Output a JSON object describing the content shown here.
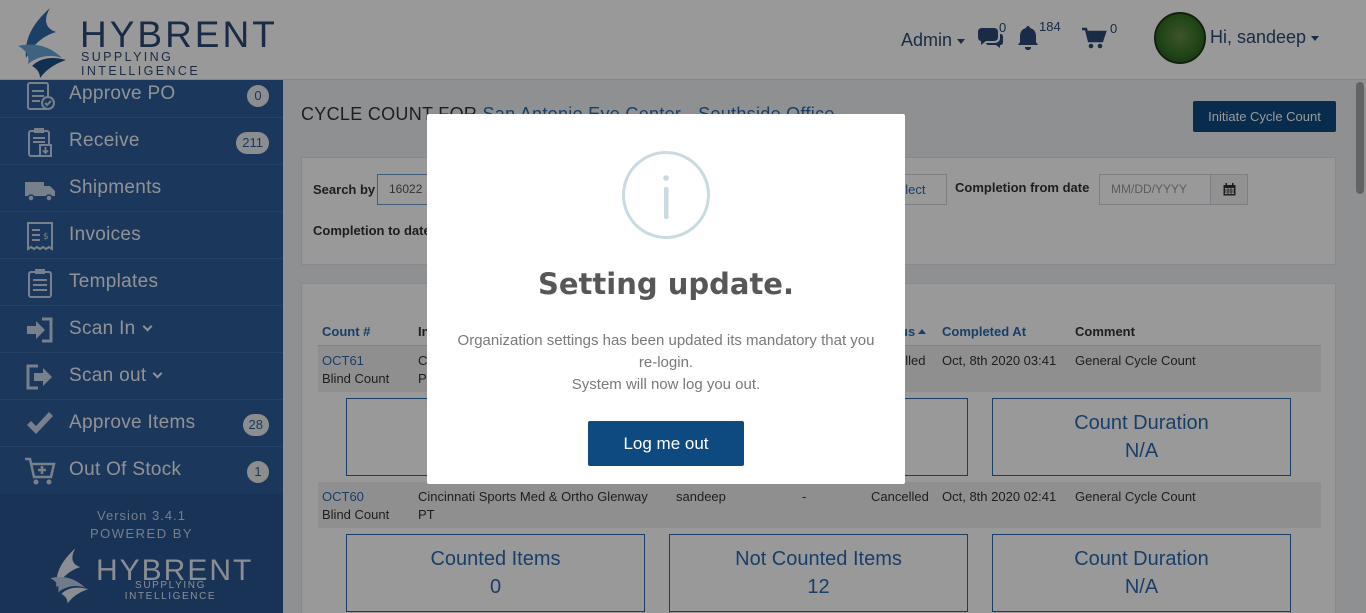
{
  "header": {
    "brand_name": "HYBRENT",
    "brand_tagline": "SUPPLYING INTELLIGENCE",
    "admin_label": "Admin",
    "messages_count": "0",
    "notifications_count": "184",
    "cart_count": "0",
    "user_greeting": "Hi, sandeep"
  },
  "sidebar": {
    "items": [
      {
        "label": "Approve PO",
        "badge": "0",
        "icon": "approve-po-icon"
      },
      {
        "label": "Receive",
        "badge": "211",
        "icon": "receive-icon"
      },
      {
        "label": "Shipments",
        "badge": "",
        "icon": "truck-icon"
      },
      {
        "label": "Invoices",
        "badge": "",
        "icon": "invoice-icon"
      },
      {
        "label": "Templates",
        "badge": "",
        "icon": "clipboard-icon"
      },
      {
        "label": "Scan In",
        "badge": "",
        "icon": "sign-in-icon"
      },
      {
        "label": "Scan out",
        "badge": "",
        "icon": "sign-out-icon"
      },
      {
        "label": "Approve Items",
        "badge": "28",
        "icon": "check-icon"
      },
      {
        "label": "Out Of Stock",
        "badge": "1",
        "icon": "cart-icon"
      }
    ],
    "version": "Version 3.4.1",
    "powered_by": "POWERED BY",
    "footer_brand": "HYBRENT",
    "footer_tagline": "SUPPLYING INTELLIGENCE"
  },
  "main": {
    "title_prefix": "CYCLE COUNT FOR",
    "title_location": "San Antonio Eye Center - Southside Office",
    "initiate_button": "Initiate Cycle Count",
    "filters": {
      "search_by_label": "Search by",
      "search_value": "16022",
      "select_label": "elect",
      "completion_from_label": "Completion from date",
      "completion_from_placeholder": "MM/DD/YYYY",
      "completion_to_label": "Completion to date"
    },
    "table": {
      "headers": {
        "count": "Count #",
        "inventory": "In",
        "status": "us",
        "completed_at": "Completed At",
        "comment": "Comment"
      },
      "rows": [
        {
          "count_no": "OCT61",
          "type": "Blind Count",
          "inventory_line1": "C",
          "inventory_line2": "P",
          "user": "",
          "dash": "",
          "status": "elled",
          "completed_at": "Oct, 8th 2020 03:41",
          "comment": "General Cycle Count",
          "stats": {
            "counted_label": "",
            "counted_value": "",
            "not_counted_label": "",
            "not_counted_value": "",
            "duration_label": "Count Duration",
            "duration_value": "N/A"
          }
        },
        {
          "count_no": "OCT60",
          "type": "Blind Count",
          "inventory_line1": "Cincinnati Sports Med & Ortho Glenway",
          "inventory_line2": "PT",
          "user": "sandeep",
          "dash": "-",
          "status": "Cancelled",
          "completed_at": "Oct, 8th 2020 02:41",
          "comment": "General Cycle Count",
          "stats": {
            "counted_label": "Counted Items",
            "counted_value": "0",
            "not_counted_label": "Not Counted Items",
            "not_counted_value": "12",
            "duration_label": "Count Duration",
            "duration_value": "N/A"
          }
        }
      ]
    }
  },
  "modal": {
    "title": "Setting update.",
    "message_line1": "Organization settings has been updated its mandatory that you re-login.",
    "message_line2": "System will now log you out.",
    "button_label": "Log me out"
  },
  "colors": {
    "sidebar_bg": "#2e5e9a",
    "primary_button": "#0e4a80",
    "link": "#2a6ab0",
    "brand": "#2c4a73"
  }
}
